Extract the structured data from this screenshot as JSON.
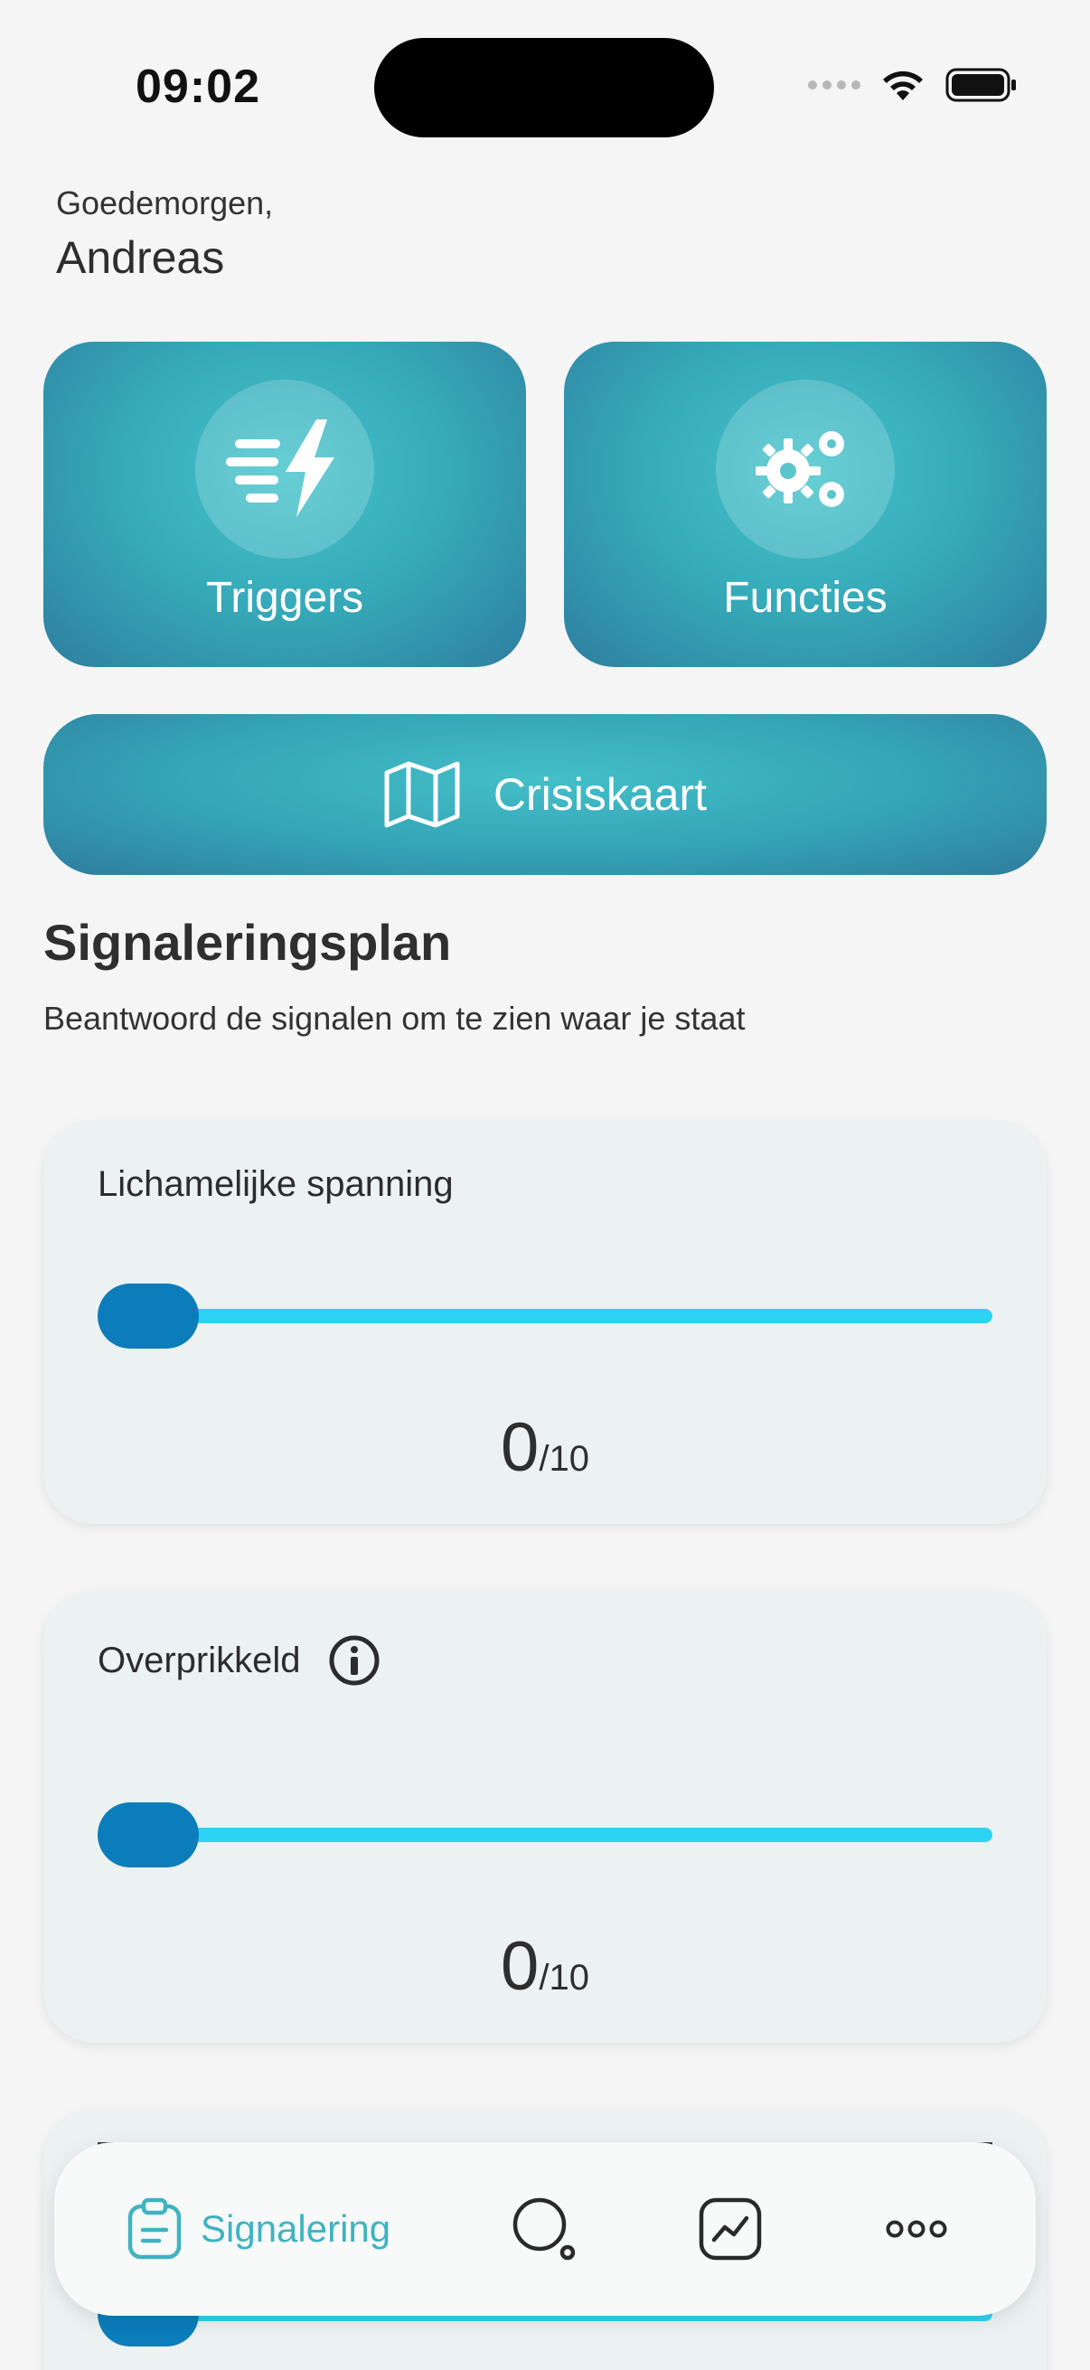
{
  "status_bar": {
    "time": "09:02"
  },
  "greeting": {
    "salutation": "Goedemorgen,",
    "name": "Andreas"
  },
  "tiles": {
    "triggers": {
      "label": "Triggers",
      "icon": "lightning-speed-icon"
    },
    "functies": {
      "label": "Functies",
      "icon": "gears-icon"
    }
  },
  "crisis": {
    "label": "Crisiskaart",
    "icon": "map-icon"
  },
  "section": {
    "title": "Signaleringsplan",
    "subtitle": "Beantwoord de signalen om te zien waar je staat"
  },
  "signals": [
    {
      "label": "Lichamelijke spanning",
      "value": "0",
      "max": "/10",
      "info": false
    },
    {
      "label": "Overprikkeld",
      "value": "0",
      "max": "/10",
      "info": true
    }
  ],
  "bottom_nav": {
    "signalering_label": "Signalering",
    "items": [
      "clipboard-icon",
      "search-icon",
      "chart-icon",
      "more-icon"
    ]
  },
  "colors": {
    "accent": "#3fb3c1",
    "tile_start": "#46c4cc",
    "tile_end": "#2e7ea0",
    "slider_track": "#2dd3f2",
    "slider_thumb": "#0b7dbb"
  }
}
